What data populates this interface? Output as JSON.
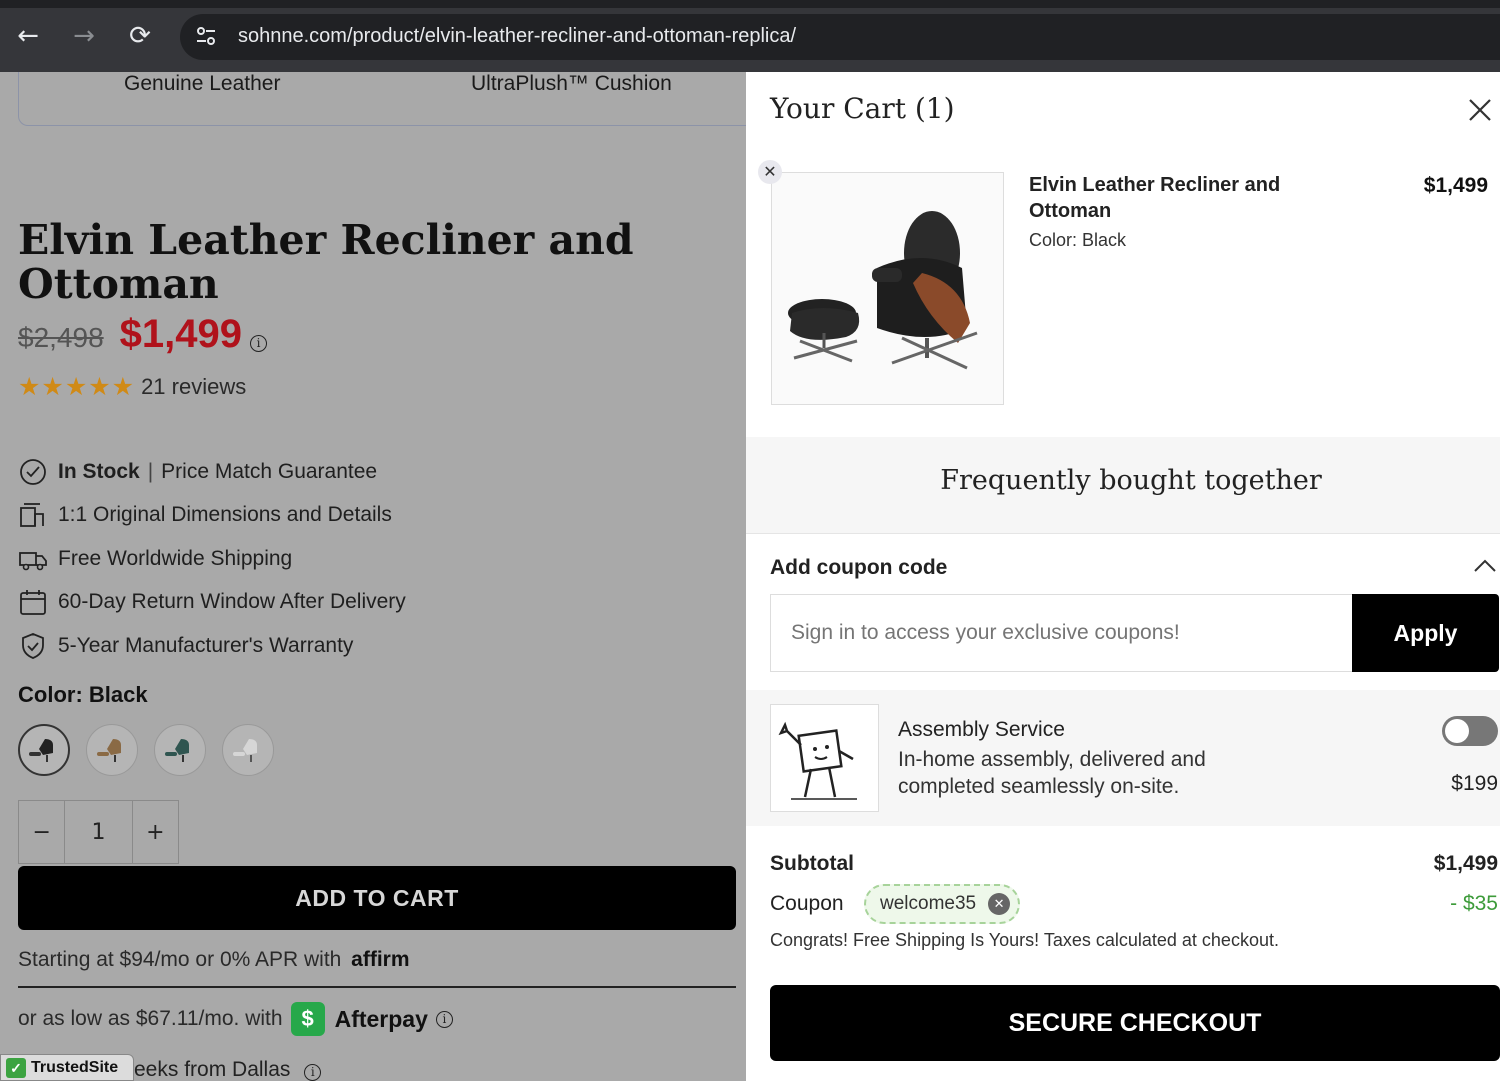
{
  "browser": {
    "url": "sohnne.com/product/elvin-leather-recliner-and-ottoman-replica/",
    "back_glyph": "←",
    "forward_glyph": "→",
    "reload_glyph": "⟳"
  },
  "product": {
    "features_bar": [
      "Genuine Leather",
      "UltraPlush™ Cushion"
    ],
    "title": "Elvin Leather Recliner and Ottoman",
    "old_price": "$2,498",
    "price": "$1,499",
    "stars": "★★★★★",
    "rating": 5,
    "reviews": "21 reviews",
    "features": {
      "stock_bold": "In Stock",
      "stock_rest": "Price Match Guarantee",
      "dimensions": "1:1 Original Dimensions and Details",
      "shipping": "Free Worldwide Shipping",
      "returns": "60-Day Return Window After Delivery",
      "warranty": "5-Year Manufacturer's Warranty"
    },
    "color_label": "Color: Black",
    "swatches": [
      "Black",
      "Tan",
      "Teal",
      "White"
    ],
    "quantity": "1",
    "qty_minus": "−",
    "qty_plus": "+",
    "add_to_cart": "ADD TO CART",
    "affirm_text": "Starting at $94/mo or 0% APR with",
    "affirm_logo": "affirm",
    "afterpay_text": "or as low as $67.11/mo. with",
    "afterpay_name": "Afterpay",
    "trusted_site": "TrustedSite",
    "dallas_text": "eeks from Dallas"
  },
  "cart": {
    "title": "Your Cart (1)",
    "item": {
      "name": "Elvin Leather Recliner and Ottoman",
      "color": "Color: Black",
      "price": "$1,499"
    },
    "fbt_title": "Frequently bought together",
    "coupon_heading": "Add coupon code",
    "coupon_placeholder": "Sign in to access your exclusive coupons!",
    "apply_label": "Apply",
    "assembly": {
      "title": "Assembly Service",
      "description": "In-home assembly, delivered and completed seamlessly on-site.",
      "price": "$199",
      "enabled": false
    },
    "subtotal_label": "Subtotal",
    "subtotal_value": "$1,499",
    "coupon_label": "Coupon",
    "coupon_code": "welcome35",
    "coupon_discount": "- $35",
    "congrats": "Congrats! Free Shipping Is Yours! Taxes calculated at checkout.",
    "checkout_label": "SECURE CHECKOUT"
  },
  "colors": {
    "accent_price": "#b0121b",
    "stars": "#d08a16",
    "discount": "#3d9b3a",
    "afterpay": "#27a84a"
  }
}
